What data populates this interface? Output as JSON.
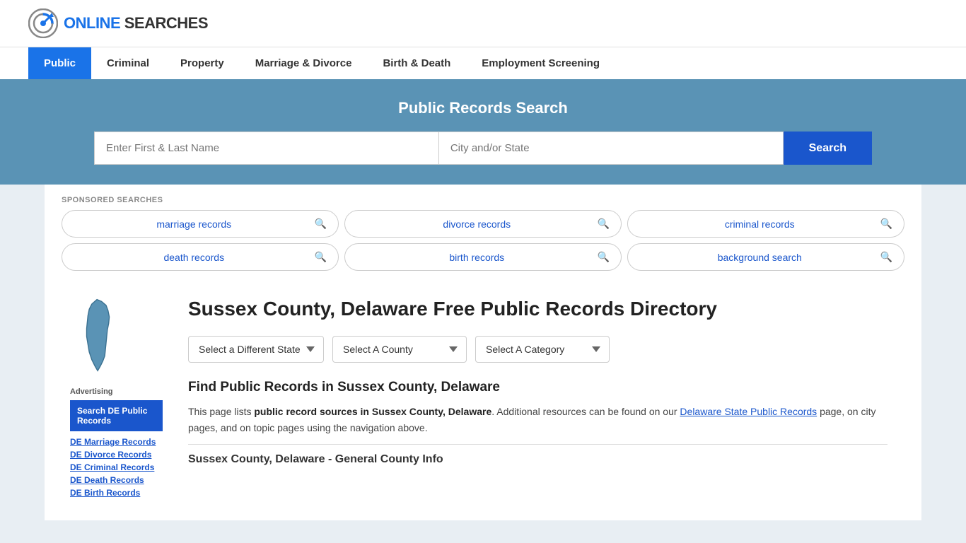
{
  "logo": {
    "text_online": "ONLINE",
    "text_searches": "SEARCHES"
  },
  "nav": {
    "items": [
      {
        "label": "Public",
        "active": true
      },
      {
        "label": "Criminal",
        "active": false
      },
      {
        "label": "Property",
        "active": false
      },
      {
        "label": "Marriage & Divorce",
        "active": false
      },
      {
        "label": "Birth & Death",
        "active": false
      },
      {
        "label": "Employment Screening",
        "active": false
      }
    ]
  },
  "hero": {
    "title": "Public Records Search",
    "input1_placeholder": "Enter First & Last Name",
    "input2_placeholder": "City and/or State",
    "search_label": "Search"
  },
  "sponsored": {
    "label": "SPONSORED SEARCHES",
    "items": [
      {
        "text": "marriage records"
      },
      {
        "text": "divorce records"
      },
      {
        "text": "criminal records"
      },
      {
        "text": "death records"
      },
      {
        "text": "birth records"
      },
      {
        "text": "background search"
      }
    ]
  },
  "page": {
    "title": "Sussex County, Delaware Free Public Records Directory",
    "dropdowns": {
      "state": "Select a Different State",
      "county": "Select A County",
      "category": "Select A Category"
    },
    "find_title": "Find Public Records in Sussex County, Delaware",
    "description_part1": "This page lists ",
    "description_bold1": "public record sources in Sussex County, Delaware",
    "description_part2": ". Additional resources can be found on our ",
    "description_link": "Delaware State Public Records",
    "description_part3": " page, on city pages, and on topic pages using the navigation above.",
    "county_info_title": "Sussex County, Delaware - General County Info"
  },
  "sidebar": {
    "ad_label": "Advertising",
    "ad_main": "Search DE Public Records",
    "links": [
      {
        "label": "DE Marriage Records"
      },
      {
        "label": "DE Divorce Records"
      },
      {
        "label": "DE Criminal Records"
      },
      {
        "label": "DE Death Records"
      },
      {
        "label": "DE Birth Records"
      }
    ]
  }
}
